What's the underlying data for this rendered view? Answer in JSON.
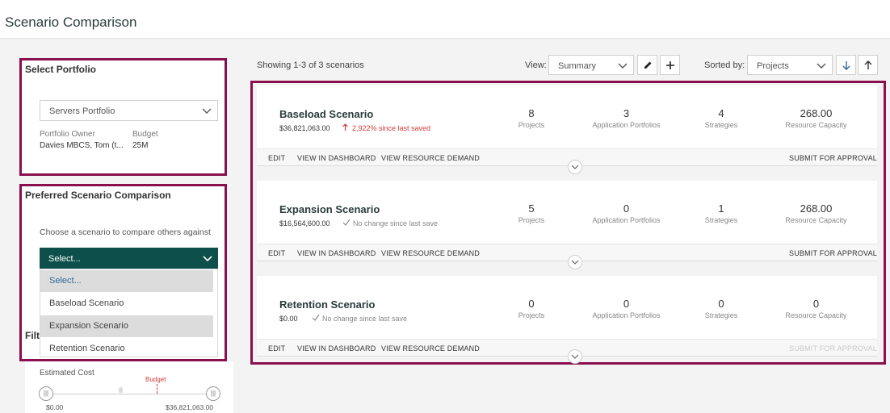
{
  "page": {
    "title": "Scenario Comparison"
  },
  "portfolio": {
    "heading": "Select Portfolio",
    "selected": "Servers Portfolio",
    "owner_label": "Portfolio Owner",
    "owner_value": "Davies MBCS, Tom (t...",
    "budget_label": "Budget",
    "budget_value": "25M"
  },
  "preferred": {
    "heading": "Preferred Scenario Comparison",
    "instruction": "Choose a scenario to compare others against",
    "select_value": "Select...",
    "options": [
      "Select...",
      "Baseload Scenario",
      "Expansion Scenario",
      "Retention Scenario"
    ]
  },
  "filters": {
    "heading_partial": "Filt",
    "estimated_cost_label": "Estimated Cost",
    "budget_marker": "Budget",
    "min_value": "$0.00",
    "max_value": "$36,821,063.00"
  },
  "toolbar": {
    "showing": "Showing 1-3 of 3 scenarios",
    "view_label": "View:",
    "view_value": "Summary",
    "sorted_label": "Sorted by:",
    "sorted_value": "Projects"
  },
  "metric_labels": [
    "Projects",
    "Application Portfolios",
    "Strategies",
    "Resource Capacity"
  ],
  "actions": {
    "edit": "EDIT",
    "dashboard": "VIEW IN DASHBOARD",
    "demand": "VIEW RESOURCE DEMAND",
    "submit": "SUBMIT FOR APPROVAL"
  },
  "scenarios": [
    {
      "name": "Baseload Scenario",
      "amount": "$36,821,063.00",
      "change": "2,922% since last saved",
      "change_color": "#d23a3a",
      "projects": "8",
      "app_portfolios": "3",
      "strategies": "4",
      "capacity": "268.00"
    },
    {
      "name": "Expansion Scenario",
      "amount": "$16,564,600.00",
      "change": "No change since last save",
      "change_color": "#888888",
      "projects": "5",
      "app_portfolios": "0",
      "strategies": "1",
      "capacity": "268.00"
    },
    {
      "name": "Retention Scenario",
      "amount": "$0.00",
      "change": "No change since last save",
      "change_color": "#888888",
      "projects": "0",
      "app_portfolios": "0",
      "strategies": "0",
      "capacity": "0"
    }
  ],
  "colors": {
    "highlight": "#8a0f4e",
    "primary": "#0d4f4a",
    "alert": "#d23a3a"
  }
}
